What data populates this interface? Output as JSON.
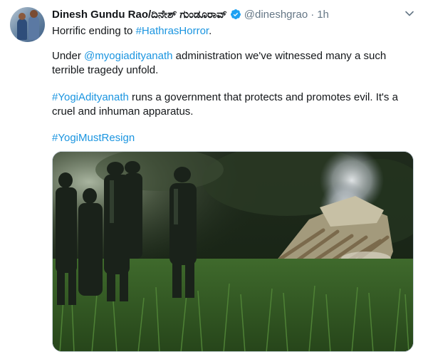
{
  "tweet": {
    "display_name": "Dinesh Gundu Rao/ದಿನೇಶ್ ಗುಂಡೂರಾವ್",
    "handle": "@dineshgrao",
    "separator": "·",
    "time": "1h",
    "line1_text": "Horrific ending to ",
    "line1_hashtag": "#HathrasHorror",
    "line1_end": ".",
    "para2_pre": "Under ",
    "para2_mention": "@myogiadityanath",
    "para2_post": " administration we've witnessed many a such terrible tragedy unfold.",
    "para3_hashtag": "#YogiAdityanath",
    "para3_post": " runs a government that protects and promotes evil. It's a cruel and inhuman apparatus.",
    "para4_hashtag": "#YogiMustResign"
  },
  "icons": {
    "verified": "verified-badge-icon",
    "menu": "chevron-down-icon"
  },
  "colors": {
    "link": "#1b95e0",
    "muted": "#657786",
    "text": "#14171a"
  }
}
